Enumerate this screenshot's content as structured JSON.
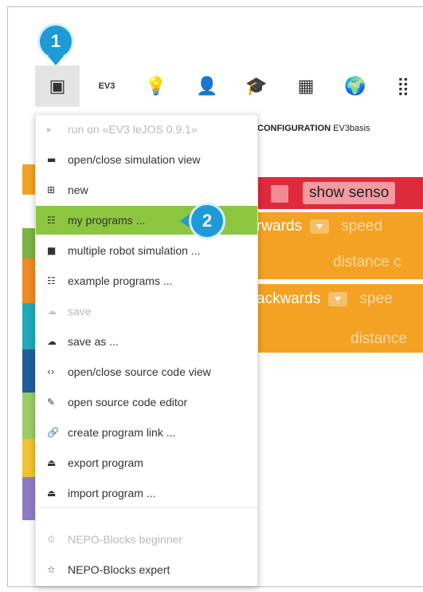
{
  "toolbar": {
    "items": [
      {
        "name": "program-menu-icon",
        "glyph": "▣"
      },
      {
        "name": "ev3-label",
        "text": "EV3"
      },
      {
        "name": "lightbulb-icon",
        "glyph": "💡"
      },
      {
        "name": "person-icon",
        "glyph": "👤"
      },
      {
        "name": "graduation-cap-icon",
        "glyph": "🎓"
      },
      {
        "name": "gallery-icon",
        "glyph": "▦"
      },
      {
        "name": "globe-icon",
        "glyph": "🌍"
      },
      {
        "name": "apps-grid-icon",
        "glyph": "⣿"
      }
    ]
  },
  "program": {
    "configuration_label": "CONFIGURATION",
    "configuration_name": "EV3basis",
    "show_sensor_label": "show senso",
    "forwards_label": "rwards",
    "speed_label": "speed",
    "distance_label_1": "distance c",
    "backwards_label": "ackwards",
    "speed_label_2": "spee",
    "distance_label_2": "distance"
  },
  "menu": {
    "items": [
      {
        "icon": "▸",
        "label": "run on «EV3 leJOS 0.9.1»",
        "disabled": true,
        "highlight": false
      },
      {
        "icon": "▬",
        "label": "open/close simulation view",
        "disabled": false,
        "highlight": false
      },
      {
        "icon": "⊞",
        "label": "new",
        "disabled": false,
        "highlight": false
      },
      {
        "icon": "☷",
        "label": "my programs ...",
        "disabled": false,
        "highlight": true
      },
      {
        "icon": "■",
        "label": "multiple robot simulation ...",
        "disabled": false,
        "highlight": false
      },
      {
        "icon": "☷",
        "label": "example programs ...",
        "disabled": false,
        "highlight": false
      },
      {
        "icon": "☁",
        "label": "save",
        "disabled": true,
        "highlight": false
      },
      {
        "icon": "☁",
        "label": "save as ...",
        "disabled": false,
        "highlight": false
      },
      {
        "icon": "‹›",
        "label": "open/close source code view",
        "disabled": false,
        "highlight": false
      },
      {
        "icon": "✎",
        "label": "open source code editor",
        "disabled": false,
        "highlight": false
      },
      {
        "icon": "🔗",
        "label": "create program link ...",
        "disabled": false,
        "highlight": false
      },
      {
        "icon": "⏏",
        "label": "export program",
        "disabled": false,
        "highlight": false
      },
      {
        "icon": "⏏",
        "label": "import program ...",
        "disabled": false,
        "highlight": false
      },
      {
        "icon": "⚙",
        "label": "NEPO-Blocks beginner",
        "disabled": true,
        "highlight": false
      },
      {
        "icon": "☆",
        "label": "NEPO-Blocks expert",
        "disabled": false,
        "highlight": false
      }
    ]
  },
  "callouts": {
    "one": "1",
    "two": "2"
  },
  "colors": {
    "menu_highlight": "#8cc63f",
    "callout": "#1e9ad6",
    "block_red": "#e0293a",
    "block_orange": "#f4a223"
  }
}
